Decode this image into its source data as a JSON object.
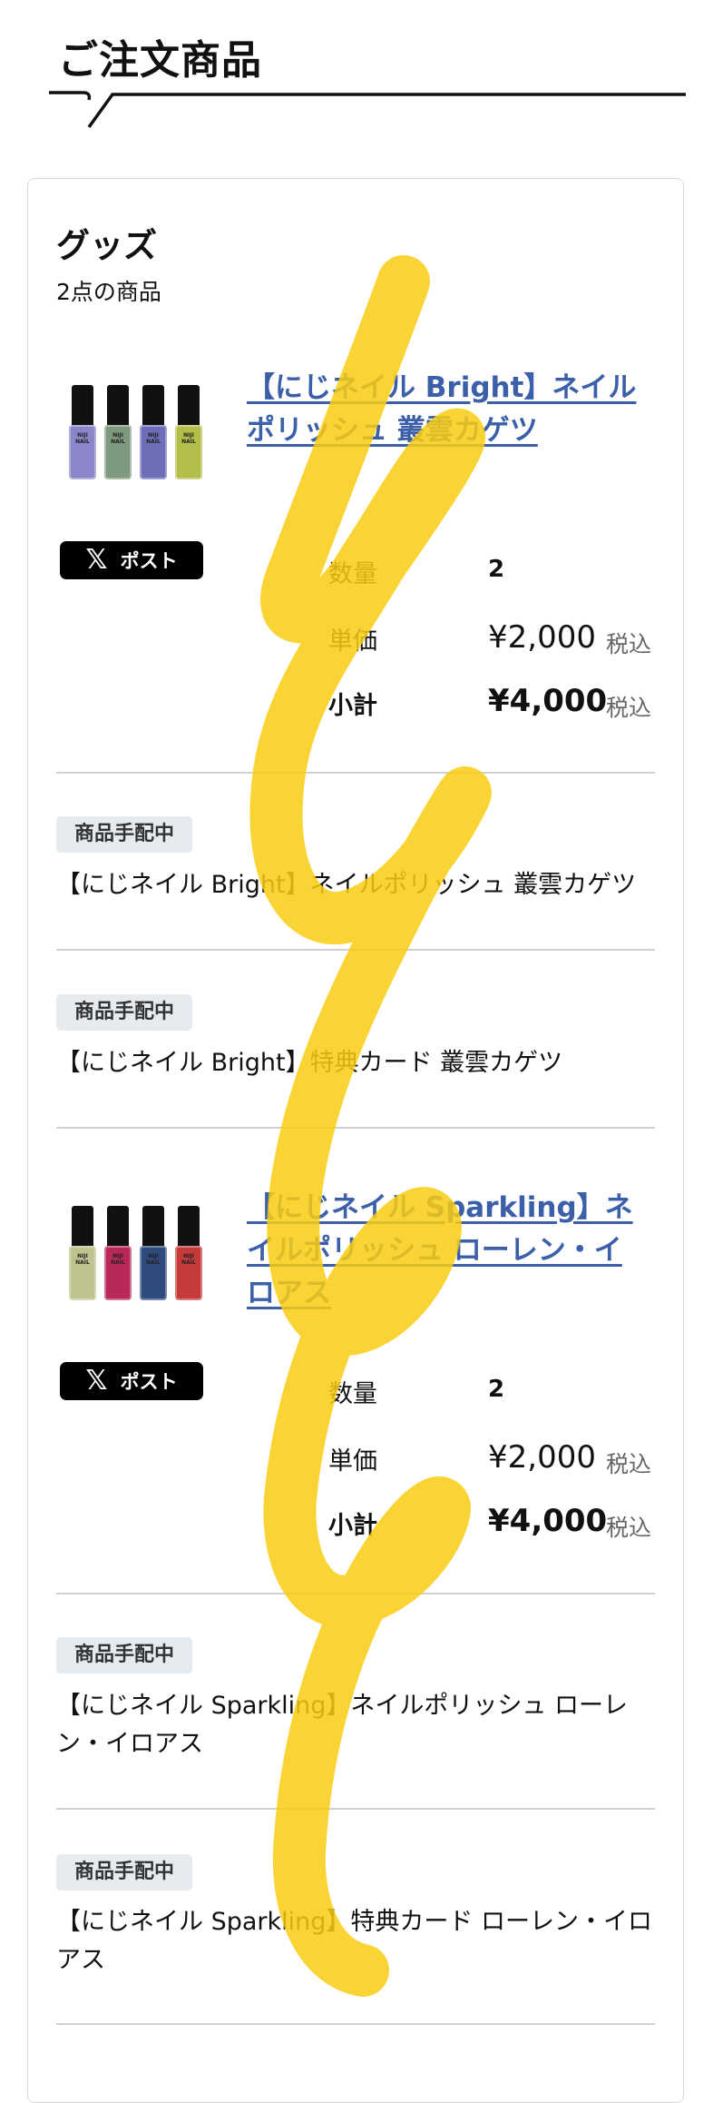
{
  "page": {
    "title": "ご注文商品"
  },
  "category": {
    "title": "グッズ",
    "count_text": "2点の商品"
  },
  "products": [
    {
      "name": "【にじネイル Bright】ネイルポリッシュ 叢雲カゲツ",
      "post_label": "ポスト",
      "bottle_colors": [
        "#8b86c9",
        "#7d9a7e",
        "#6d6db8",
        "#b3bd4a"
      ],
      "bottle_label": "NIJI NAIL",
      "quantity_label": "数量",
      "quantity": "2",
      "unit_price_label": "単価",
      "unit_price": "¥2,000",
      "subtotal_label": "小計",
      "subtotal": "¥4,000",
      "tax_label": "税込",
      "statuses": [
        {
          "badge": "商品手配中",
          "text": "【にじネイル Bright】ネイルポリッシュ 叢雲カゲツ"
        },
        {
          "badge": "商品手配中",
          "text": "【にじネイル Bright】特典カード 叢雲カゲツ"
        }
      ]
    },
    {
      "name": "【にじネイル Sparkling】ネイルポリッシュ ローレン・イロアス",
      "post_label": "ポスト",
      "bottle_colors": [
        "#bfc48f",
        "#b8285a",
        "#2f4a7d",
        "#c53a3a"
      ],
      "bottle_label": "NIJI NAIL",
      "quantity_label": "数量",
      "quantity": "2",
      "unit_price_label": "単価",
      "unit_price": "¥2,000",
      "subtotal_label": "小計",
      "subtotal": "¥4,000",
      "tax_label": "税込",
      "statuses": [
        {
          "badge": "商品手配中",
          "text": "【にじネイル Sparkling】ネイルポリッシュ ローレン・イロアス"
        },
        {
          "badge": "商品手配中",
          "text": "【にじネイル Sparkling】特典カード ローレン・イロアス"
        }
      ]
    }
  ],
  "colors": {
    "link": "#3b5fa8",
    "badge_bg": "#e6ebf0",
    "swirl": "#f9cd12"
  }
}
